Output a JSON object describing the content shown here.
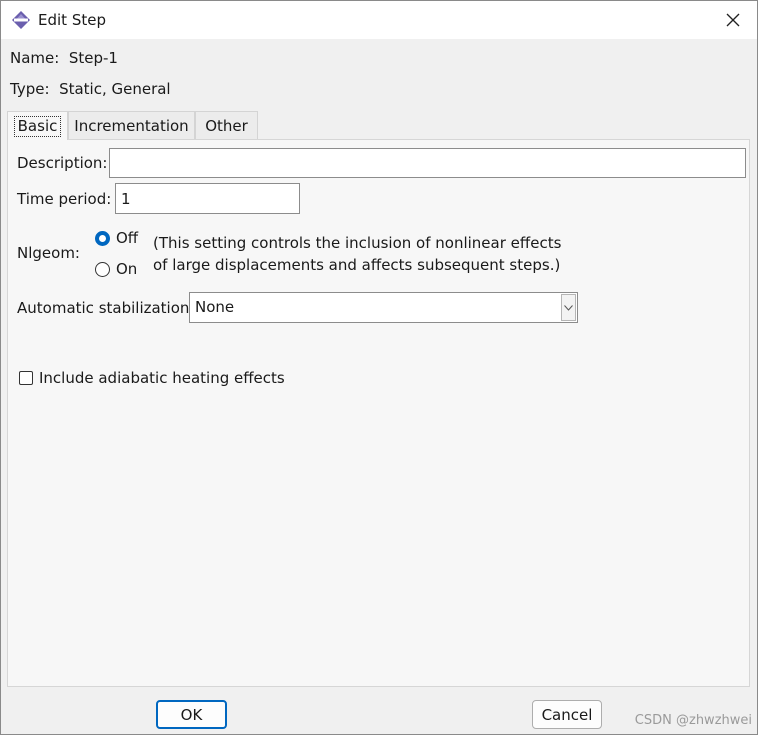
{
  "window": {
    "title": "Edit Step",
    "app_icon": "abaqus-step-icon",
    "close_icon": "close-icon"
  },
  "info": {
    "name_label": "Name:",
    "name_value": "Step-1",
    "type_label": "Type:",
    "type_value": "Static, General"
  },
  "tabs": [
    {
      "label": "Basic",
      "active": true
    },
    {
      "label": "Incrementation",
      "active": false
    },
    {
      "label": "Other",
      "active": false
    }
  ],
  "basic": {
    "description_label": "Description:",
    "description_value": "",
    "time_period_label": "Time period:",
    "time_period_value": "1",
    "nlgeom_label": "Nlgeom:",
    "nlgeom_off_label": "Off",
    "nlgeom_on_label": "On",
    "nlgeom_selected": "Off",
    "nlgeom_note_line1": "(This setting controls the inclusion of nonlinear effects",
    "nlgeom_note_line2": "of large displacements and affects subsequent steps.)",
    "stabilization_label": "Automatic stabilization:",
    "stabilization_value": "None",
    "adiabatic_label": "Include adiabatic heating effects",
    "adiabatic_checked": false
  },
  "footer": {
    "ok_label": "OK",
    "cancel_label": "Cancel"
  },
  "watermark": "CSDN @zhwzhwei",
  "colors": {
    "accent": "#0067c0",
    "icon_purple": "#6b5fae"
  }
}
